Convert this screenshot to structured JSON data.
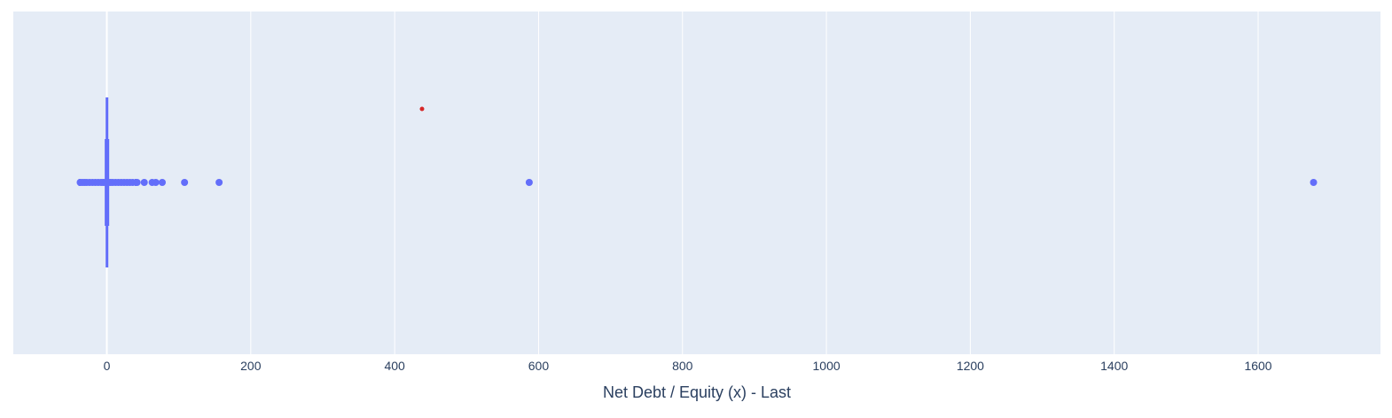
{
  "chart_data": {
    "type": "scatter",
    "subtype": "horizontal box plot with outlier points and marked value",
    "title": "",
    "xlabel": "Net Debt / Equity (x) - Last",
    "ylabel": "",
    "xlim": [
      -130,
      1770
    ],
    "x_ticks": [
      0,
      200,
      400,
      600,
      800,
      1000,
      1200,
      1400,
      1600
    ],
    "x_tick_labels": [
      "0",
      "200",
      "400",
      "600",
      "800",
      "1000",
      "1200",
      "1400",
      "1600"
    ],
    "grid": true,
    "legend": "none",
    "box": {
      "min": -38,
      "q1": -0.5,
      "median": 0.2,
      "q3": 0.8,
      "max": 40,
      "color": "#636efa"
    },
    "outliers": [
      -37,
      -34,
      -31,
      -28,
      -24,
      -20,
      -16,
      -12,
      -8,
      -5,
      -2,
      2,
      5,
      8,
      12,
      16,
      20,
      24,
      28,
      32,
      36,
      42,
      52,
      63,
      68,
      77,
      108,
      156,
      587,
      1677
    ],
    "marked_point": {
      "x": 438,
      "color": "#d62728"
    },
    "colors": {
      "plot_bg": "#e5ecf6",
      "grid": "#ffffff",
      "series": "#636efa",
      "text": "#2a3f5f"
    }
  }
}
